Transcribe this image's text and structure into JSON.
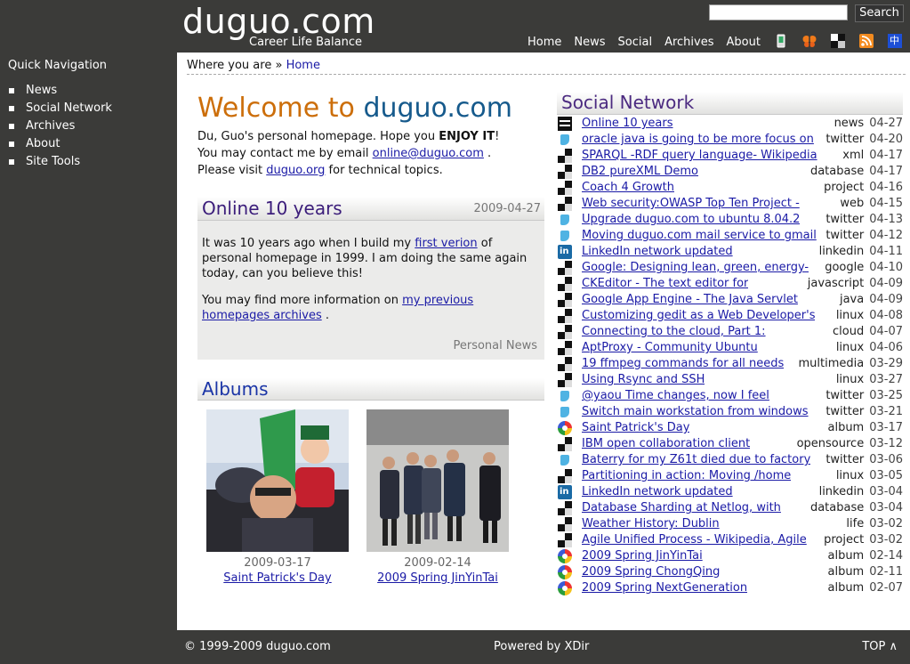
{
  "header": {
    "site_title": "duguo.com",
    "tagline": "Career Life Balance",
    "search_button": "Search",
    "nav": [
      "Home",
      "News",
      "Social",
      "Archives",
      "About"
    ],
    "icons": [
      "mobile-icon",
      "butterfly-icon",
      "delicious-icon",
      "rss-icon",
      "chinese-language-icon"
    ],
    "chinese_label": "中"
  },
  "sidebar": {
    "title": "Quick Navigation",
    "items": [
      "News",
      "Social Network",
      "Archives",
      "About",
      "Site Tools"
    ]
  },
  "breadcrumb": {
    "prefix": "Where you are »",
    "home": "Home"
  },
  "welcome": {
    "part1": "Welcome to",
    "part2": "duguo.com",
    "line1_a": "Du, Guo's personal homepage. Hope you ",
    "line1_b": "ENJOY IT",
    "line1_c": "!",
    "line2_a": "You may contact me by email ",
    "email": "online@duguo.com",
    "line2_b": " .",
    "line3_a": "Please visit ",
    "link": "duguo.org",
    "line3_b": " for technical topics."
  },
  "post": {
    "title": "Online 10 years",
    "date": "2009-04-27",
    "p1_a": "It was 10 years ago when I build my ",
    "p1_link": "first verion",
    "p1_b": " of personal homepage in 1999. I am doing the same again today, can you believe this!",
    "p2_a": "You may find more information on ",
    "p2_link": "my previous homepages archives",
    "p2_b": " .",
    "category": "Personal News"
  },
  "albums": {
    "title": "Albums",
    "items": [
      {
        "date": "2009-03-17",
        "name": "Saint Patrick's Day"
      },
      {
        "date": "2009-02-14",
        "name": "2009 Spring JinYinTai"
      }
    ]
  },
  "social": {
    "title": "Social Network",
    "items": [
      {
        "icon": "duguo",
        "title": "Online 10 years",
        "cat": "news",
        "date": "04-27"
      },
      {
        "icon": "twitter",
        "title": "oracle java is going to be more focus on",
        "cat": "twitter",
        "date": "04-20"
      },
      {
        "icon": "delicious",
        "title": "SPARQL -RDF query language- Wikipedia",
        "cat": "xml",
        "date": "04-17"
      },
      {
        "icon": "delicious",
        "title": "DB2 pureXML Demo",
        "cat": "database",
        "date": "04-17"
      },
      {
        "icon": "delicious",
        "title": "Coach 4 Growth",
        "cat": "project",
        "date": "04-16"
      },
      {
        "icon": "delicious",
        "title": "Web security:OWASP Top Ten Project -",
        "cat": "web",
        "date": "04-15"
      },
      {
        "icon": "twitter",
        "title": "Upgrade duguo.com to ubuntu 8.04.2",
        "cat": "twitter",
        "date": "04-13"
      },
      {
        "icon": "twitter",
        "title": "Moving duguo.com mail service to gmail",
        "cat": "twitter",
        "date": "04-12"
      },
      {
        "icon": "linkedin",
        "title": "LinkedIn network updated",
        "cat": "linkedin",
        "date": "04-11"
      },
      {
        "icon": "delicious",
        "title": "Google: Designing lean, green, energy-",
        "cat": "google",
        "date": "04-10"
      },
      {
        "icon": "delicious",
        "title": "CKEditor - The text editor for",
        "cat": "javascript",
        "date": "04-09"
      },
      {
        "icon": "delicious",
        "title": "Google App Engine - The Java Servlet",
        "cat": "java",
        "date": "04-09"
      },
      {
        "icon": "delicious",
        "title": "Customizing gedit as a Web Developer's",
        "cat": "linux",
        "date": "04-08"
      },
      {
        "icon": "delicious",
        "title": "Connecting to the cloud, Part 1:",
        "cat": "cloud",
        "date": "04-07"
      },
      {
        "icon": "delicious",
        "title": "AptProxy - Community Ubuntu",
        "cat": "linux",
        "date": "04-06"
      },
      {
        "icon": "delicious",
        "title": "19 ffmpeg commands for all needs",
        "cat": "multimedia",
        "date": "03-29"
      },
      {
        "icon": "delicious",
        "title": "Using Rsync and SSH",
        "cat": "linux",
        "date": "03-27"
      },
      {
        "icon": "twitter",
        "title": "@yaou Time changes, now I feel",
        "cat": "twitter",
        "date": "03-25"
      },
      {
        "icon": "twitter",
        "title": "Switch main workstation from windows",
        "cat": "twitter",
        "date": "03-21"
      },
      {
        "icon": "picasa",
        "title": "Saint Patrick's Day",
        "cat": "album",
        "date": "03-17"
      },
      {
        "icon": "delicious",
        "title": "IBM open collaboration client",
        "cat": "opensource",
        "date": "03-12"
      },
      {
        "icon": "twitter",
        "title": "Baterry for my Z61t died due to factory",
        "cat": "twitter",
        "date": "03-06"
      },
      {
        "icon": "delicious",
        "title": "Partitioning in action: Moving /home",
        "cat": "linux",
        "date": "03-05"
      },
      {
        "icon": "linkedin",
        "title": "LinkedIn network updated",
        "cat": "linkedin",
        "date": "03-04"
      },
      {
        "icon": "delicious",
        "title": "Database Sharding at Netlog, with",
        "cat": "database",
        "date": "03-04"
      },
      {
        "icon": "delicious",
        "title": "Weather History: Dublin",
        "cat": "life",
        "date": "03-02"
      },
      {
        "icon": "delicious",
        "title": "Agile Unified Process - Wikipedia, Agile",
        "cat": "project",
        "date": "03-02"
      },
      {
        "icon": "picasa",
        "title": "2009 Spring JinYinTai",
        "cat": "album",
        "date": "02-14"
      },
      {
        "icon": "picasa",
        "title": "2009 Spring ChongQing",
        "cat": "album",
        "date": "02-11"
      },
      {
        "icon": "picasa",
        "title": "2009 Spring NextGeneration",
        "cat": "album",
        "date": "02-07"
      }
    ]
  },
  "footer": {
    "copyright": "© 1999-2009 duguo.com",
    "powered": "Powered by XDir",
    "top": "TOP ∧"
  }
}
